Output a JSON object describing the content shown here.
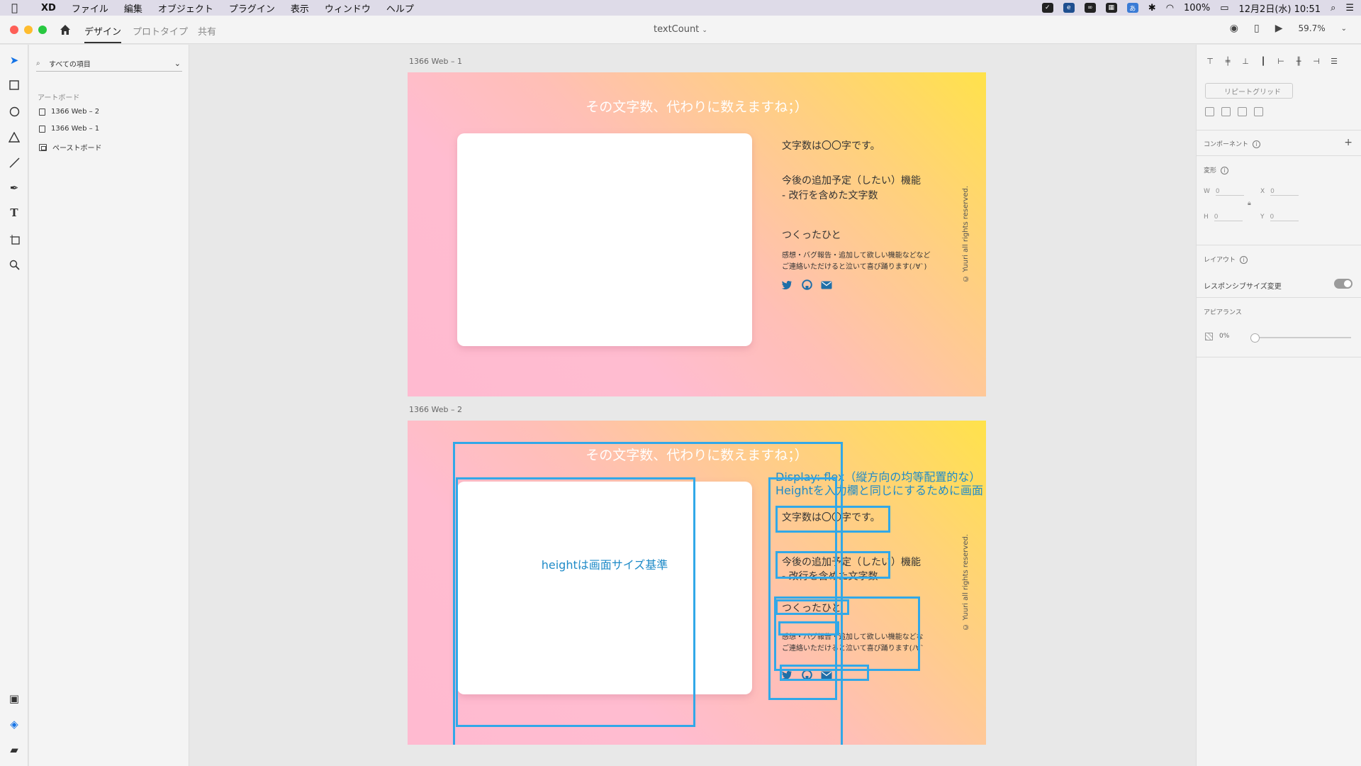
{
  "menubar": {
    "app": "XD",
    "items": [
      "ファイル",
      "編集",
      "オブジェクト",
      "プラグイン",
      "表示",
      "ウィンドウ",
      "ヘルプ"
    ],
    "battery": "100%",
    "datetime": "12月2日(水) 10:51"
  },
  "titlebar": {
    "tabs": [
      "デザイン",
      "プロトタイプ",
      "共有"
    ],
    "active_tab": "デザイン",
    "document_title": "textCount",
    "zoom": "59.7%"
  },
  "layers": {
    "search_placeholder": "すべての項目",
    "section_title": "アートボード",
    "items": [
      "1366 Web – 2",
      "1366 Web – 1",
      "ペーストボード"
    ]
  },
  "artboards": {
    "ab1": {
      "label": "1366 Web – 1",
      "title": "その文字数、代わりに数えますね；）",
      "count_text": "文字数は〇〇字です。",
      "future_title": "今後の追加予定（したい）機能",
      "future_item": "- 改行を含めた文字数",
      "maker_title": "つくったひと",
      "maker_line1": "感想・バグ報告・追加して欲しい機能などなど",
      "maker_line2": "ご連絡いただけると泣いて喜び踊ります(ﾉ∀`)",
      "copyright": "© Yuuri all rights reserved."
    },
    "ab2": {
      "label": "1366 Web – 2",
      "title": "その文字数、代わりに数えますね；）",
      "card_note": "heightは画面サイズ基準",
      "flex_note_line1": "Display: flex（縦方向の均等配置的な）",
      "flex_note_line2": "Heightを入力欄と同じにするために画面",
      "count_text": "文字数は〇〇字です。",
      "future_title": "今後の追加予定（したい）機能",
      "future_item": "- 改行を含めた文字数",
      "maker_title": "つくったひと",
      "maker_line1": "感想・バグ報告・追加して欲しい機能などなど",
      "maker_line2": "ご連絡いただけると泣いて喜び踊ります(ﾉ∀`)",
      "copyright": "© Yuuri all rights reserved."
    }
  },
  "props": {
    "repeat_grid": "リピートグリッド",
    "component": "コンポーネント",
    "transform": "変形",
    "w_label": "W",
    "w_value": "0",
    "x_label": "X",
    "x_value": "0",
    "h_label": "H",
    "h_value": "0",
    "y_label": "Y",
    "y_value": "0",
    "layout": "レイアウト",
    "responsive": "レスポンシブサイズ変更",
    "appearance": "アピアランス",
    "opacity": "0%"
  },
  "colors": {
    "guide": "#31a8e8",
    "note": "#1f8bc8",
    "icon": "#1f6fa8"
  }
}
